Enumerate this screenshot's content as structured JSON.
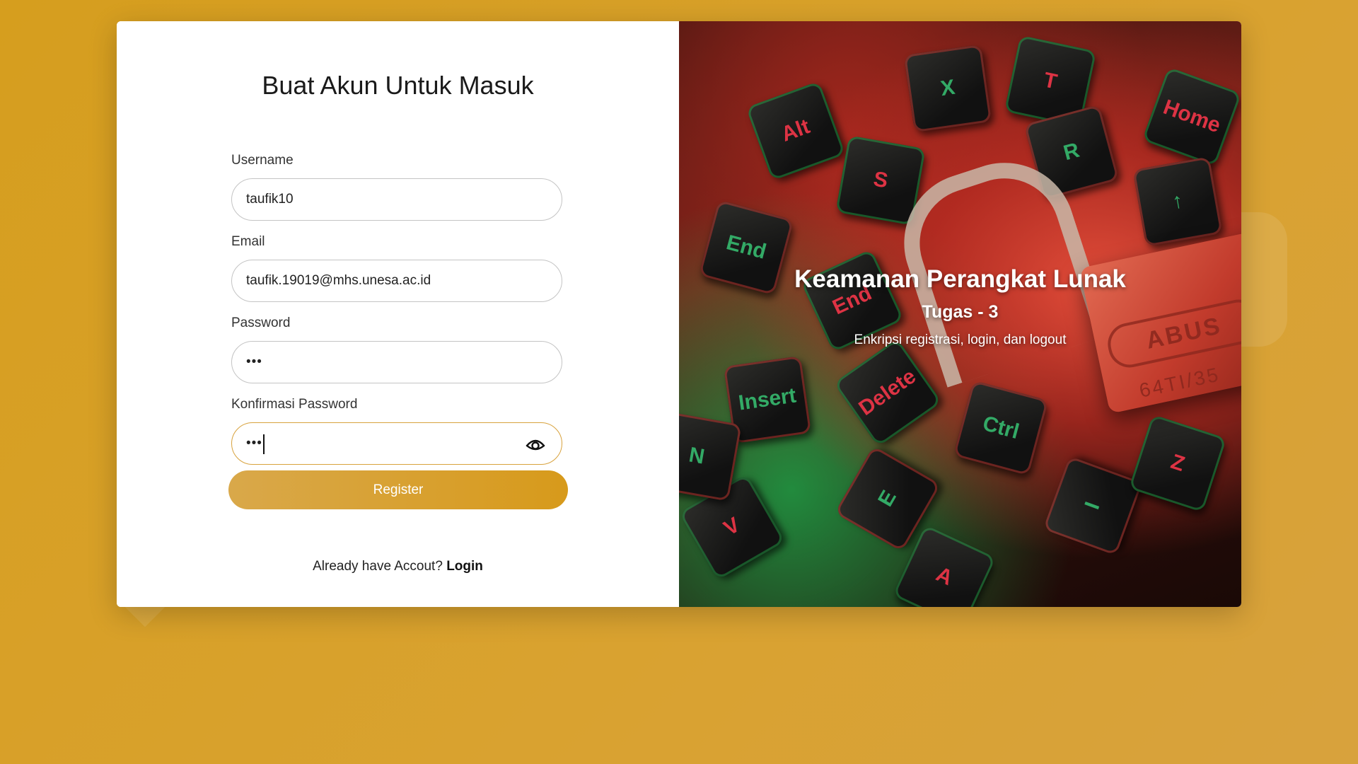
{
  "form": {
    "title": "Buat Akun Untuk Masuk",
    "username": {
      "label": "Username",
      "value": "taufik10"
    },
    "email": {
      "label": "Email",
      "value": "taufik.19019@mhs.unesa.ac.id"
    },
    "password": {
      "label": "Password",
      "value": "•••"
    },
    "confirm_password": {
      "label": "Konfirmasi Password",
      "value": "•••"
    },
    "register_label": "Register",
    "footer_text": "Already have Accout?",
    "login_link": "Login"
  },
  "hero": {
    "title": "Keamanan Perangkat Lunak",
    "subtitle": "Tugas - 3",
    "description": "Enkripsi registrasi, login, dan logout"
  },
  "colors": {
    "background": "#d69e1e",
    "accent": "#d8a23d",
    "button_start": "#d9a84a",
    "button_end": "#d79a1b"
  },
  "icons": {
    "show_password": "eye-icon"
  }
}
